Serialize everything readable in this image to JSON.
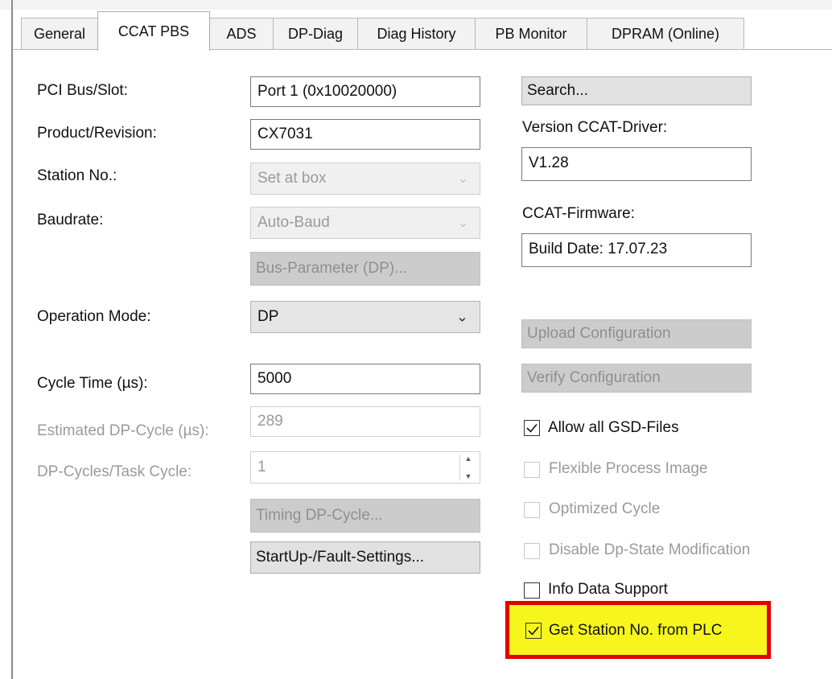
{
  "tabs": [
    "General",
    "CCAT PBS",
    "ADS",
    "DP-Diag",
    "Diag History",
    "PB Monitor",
    "DPRAM (Online)"
  ],
  "labels": {
    "pci_bus_slot": "PCI Bus/Slot:",
    "product_revision": "Product/Revision:",
    "station_no": "Station No.:",
    "baudrate": "Baudrate:",
    "operation_mode": "Operation Mode:",
    "cycle_time": "Cycle Time (µs):",
    "estimated_dp_cycle": "Estimated DP-Cycle (µs):",
    "dp_cycles_task_cycle": "DP-Cycles/Task Cycle:",
    "version_ccat_driver": "Version CCAT-Driver:",
    "ccat_firmware": "CCAT-Firmware:"
  },
  "fields": {
    "pci_bus_slot": "Port 1 (0x10020000)",
    "product_revision": "CX7031",
    "station_no": "Set at box",
    "baudrate": "Auto-Baud",
    "operation_mode": "DP",
    "cycle_time": "5000",
    "estimated_dp_cycle": "289",
    "dp_cycles_task_cycle": "1",
    "version_ccat_driver": "V1.28",
    "ccat_firmware": "Build Date: 17.07.23"
  },
  "buttons": {
    "search": "Search...",
    "bus_parameter": "Bus-Parameter (DP)...",
    "timing_dp_cycle": "Timing DP-Cycle...",
    "startup_fault_settings": "StartUp-/Fault-Settings...",
    "upload_configuration": "Upload Configuration",
    "verify_configuration": "Verify Configuration"
  },
  "checkboxes": [
    {
      "label": "Allow all GSD-Files",
      "checked": true,
      "enabled": true
    },
    {
      "label": "Flexible Process Image",
      "checked": false,
      "enabled": false
    },
    {
      "label": "Optimized Cycle",
      "checked": false,
      "enabled": false
    },
    {
      "label": "Disable Dp-State Modification",
      "checked": false,
      "enabled": false
    },
    {
      "label": "Info Data Support",
      "checked": false,
      "enabled": true
    },
    {
      "label": "Get Station No. from PLC",
      "checked": true,
      "enabled": true
    }
  ],
  "colors": {
    "highlight_border": "#e00000",
    "highlight_fill": "#f6f61c"
  }
}
